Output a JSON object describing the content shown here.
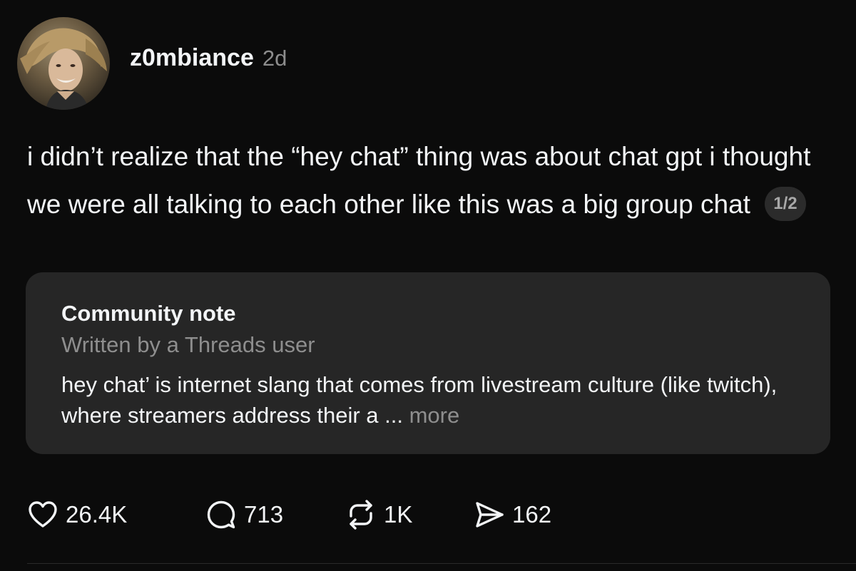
{
  "post": {
    "author": {
      "username": "z0mbiance",
      "time_ago": "2d"
    },
    "text": "i didn’t realize that the “hey chat” thing was about chat gpt i thought we were all talking to each other like this was a big group chat",
    "page_indicator": "1/2",
    "community_note": {
      "title": "Community note",
      "byline": "Written by a Threads user",
      "text": "hey chat’ is internet slang that comes from livestream culture (like twitch), where streamers address their a ...",
      "more_label": "more"
    },
    "actions": {
      "likes": "26.4K",
      "replies": "713",
      "reposts": "1K",
      "shares": "162"
    },
    "icons": {
      "like": "heart-icon",
      "reply": "comment-bubble-icon",
      "repost": "repost-arrows-icon",
      "share": "send-icon"
    },
    "colors": {
      "background": "#0b0b0b",
      "text": "#f3f5f7",
      "muted": "#8e8e8e",
      "card": "#262626"
    }
  }
}
